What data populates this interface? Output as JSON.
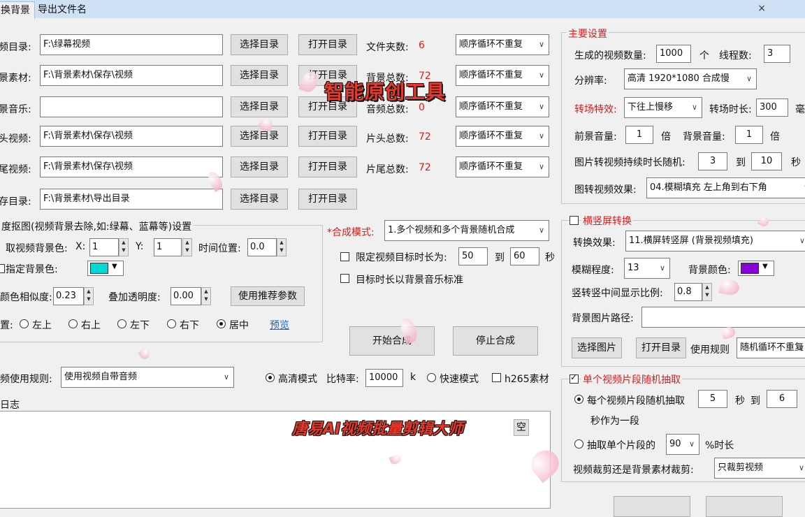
{
  "tabs": [
    "换背景",
    "导出文件名"
  ],
  "close_glyph": "×",
  "rows": [
    {
      "label": "频目录:",
      "path": "F:\\绿幕视频",
      "btn1": "选择目录",
      "btn2": "打开目录",
      "stat_label": "文件夹数:",
      "stat_value": "6",
      "mode": "顺序循环不重复"
    },
    {
      "label": "景素材:",
      "path": "F:\\背景素材\\保存\\视频",
      "btn1": "选择目录",
      "btn2": "打开目录",
      "stat_label": "背景总数:",
      "stat_value": "72",
      "mode": "顺序循环不重复"
    },
    {
      "label": "景音乐:",
      "path": "",
      "btn1": "选择目录",
      "btn2": "打开目录",
      "stat_label": "音频总数:",
      "stat_value": "0",
      "mode": "顺序循环不重复"
    },
    {
      "label": "头视频:",
      "path": "F:\\背景素材\\保存\\视频",
      "btn1": "选择目录",
      "btn2": "打开目录",
      "stat_label": "片头总数:",
      "stat_value": "72",
      "mode": "顺序循环不重复"
    },
    {
      "label": "尾视频:",
      "path": "F:\\背景素材\\保存\\视频",
      "btn1": "选择目录",
      "btn2": "打开目录",
      "stat_label": "片尾总数:",
      "stat_value": "72",
      "mode": "顺序循环不重复"
    },
    {
      "label": "存目录:",
      "path": "F:\\背景素材\\导出目录",
      "btn1": "选择目录",
      "btn2": "打开目录"
    }
  ],
  "keying": {
    "title": "度抠图(视频背景去除,如:绿幕、蓝幕等)设置",
    "pick_label": "取视频背景色:",
    "x_label": "X:",
    "x_value": "1",
    "y_label": "Y:",
    "y_value": "1",
    "time_label": "时间位置:",
    "time_value": "0.0",
    "bg_color_label": "指定背景色:",
    "bg_color": "#00d7d7",
    "similarity_label": "颜色相似度:",
    "similarity_value": "0.23",
    "opacity_label": "叠加透明度:",
    "opacity_value": "0.00",
    "recommend_btn": "使用推荐参数",
    "position_label": "置:",
    "positions": [
      "左上",
      "右上",
      "左下",
      "右下",
      "居中"
    ],
    "position_selected": "居中",
    "preview_link": "预览"
  },
  "compose": {
    "mode_label": "*合成模式:",
    "mode_value": "1.多个视频和多个背景随机合成",
    "limit_label": "限定视频目标时长为:",
    "limit_from": "50",
    "to": "到",
    "limit_to": "60",
    "sec": "秒",
    "music_label": "目标时长以背景音乐标准",
    "start_btn": "开始合成",
    "stop_btn": "停止合成"
  },
  "audio": {
    "rule_label": "频使用规则:",
    "rule_value": "使用视频自带音频",
    "hd_label": "高清模式",
    "bitrate_label": "比特率:",
    "bitrate_value": "10000",
    "bitrate_unit": "k",
    "fast_label": "快速模式",
    "h265_label": "h265素材"
  },
  "log": {
    "title": "日志",
    "clear_btn": "空"
  },
  "main_settings": {
    "title": "主要设置",
    "count_label": "生成的视频数量:",
    "count_value": "1000",
    "count_unit": "个",
    "threads_label": "线程数:",
    "threads_value": "3",
    "resolution_label": "分辨率:",
    "resolution_value": "高清 1920*1080 合成慢",
    "transition_label": "转场特效:",
    "transition_value": "下往上慢移",
    "transition_time_label": "转场时长:",
    "transition_time_value": "300",
    "transition_time_unit": "毫",
    "fg_volume_label": "前景音量:",
    "fg_volume_value": "1",
    "fg_volume_unit": "倍",
    "bg_volume_label": "背景音量:",
    "bg_volume_value": "1",
    "bg_volume_unit": "倍",
    "image_duration_label": "图片转视频持续时长随机:",
    "image_duration_from": "3",
    "image_duration_to_label": "到",
    "image_duration_to": "10",
    "image_duration_unit": "秒",
    "image_effect_label": "图转视频效果:",
    "image_effect_value": "04.模糊填充 左上角到右下角"
  },
  "orientation": {
    "title": "横竖屏转换",
    "effect_label": "转换效果:",
    "effect_value": "11.横屏转竖屏 (背景视频填充)",
    "blur_label": "模糊程度:",
    "blur_value": "13",
    "bg_color_label": "背景颜色:",
    "bg_color": "#8a00d8",
    "ratio_label": "竖转竖中间显示比例:",
    "ratio_value": "0.8",
    "bg_image_label": "背景图片路径:",
    "choose_img_btn": "选择图片",
    "open_dir_btn": "打开目录",
    "use_rule_label": "使用规则",
    "use_rule_value": "随机循环不重复"
  },
  "clip": {
    "title": "单个视频片段随机抽取",
    "each_label": "每个视频片段随机抽取",
    "each_from": "5",
    "sec1": "秒",
    "to": "到",
    "each_to": "6",
    "each_suffix": "秒作为一段",
    "pct_label": "抽取单个片段的",
    "pct_value": "90",
    "pct_suffix": "%时长",
    "crop_label": "视频裁剪还是背景素材裁剪:",
    "crop_value": "只裁剪视频"
  },
  "overlay": {
    "headline": "智能原创工具",
    "tagline": "唐易AI视频批量剪辑大师"
  }
}
